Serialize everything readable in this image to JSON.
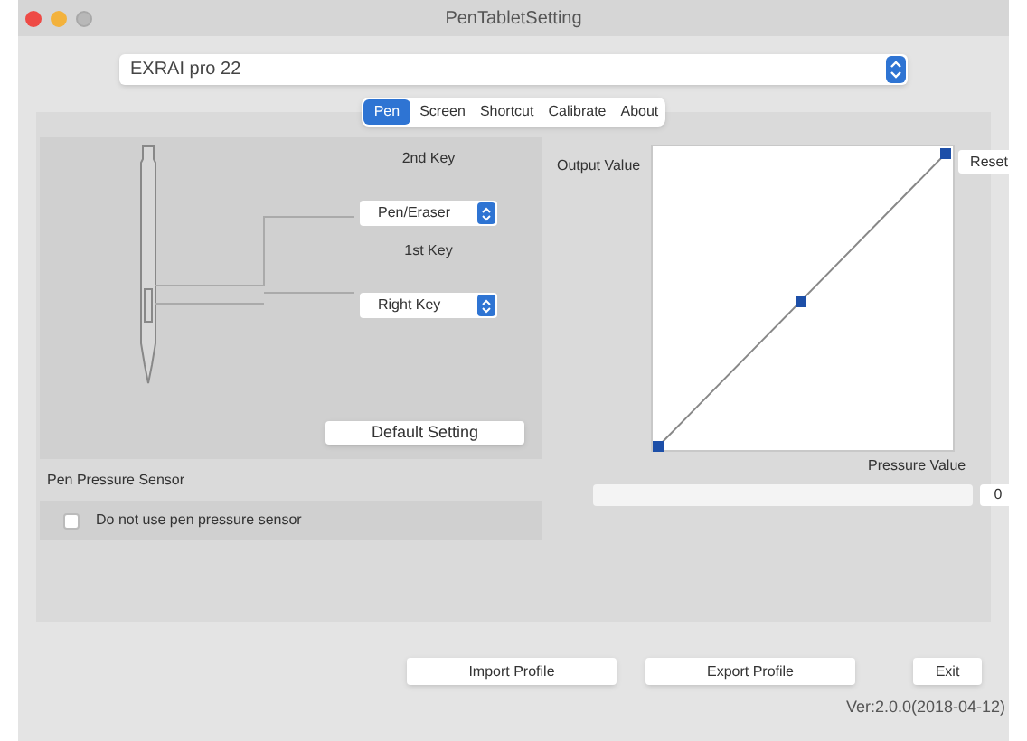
{
  "window": {
    "title": "PenTabletSetting"
  },
  "device_select": {
    "value": "EXRAI pro 22"
  },
  "tabs": [
    {
      "label": "Pen",
      "selected": true
    },
    {
      "label": "Screen",
      "selected": false
    },
    {
      "label": "Shortcut",
      "selected": false
    },
    {
      "label": "Calibrate",
      "selected": false
    },
    {
      "label": "About",
      "selected": false
    }
  ],
  "pen_keys": [
    {
      "label": "2nd Key",
      "value": "Pen/Eraser"
    },
    {
      "label": "1st Key",
      "value": "Right Key"
    }
  ],
  "default_button": "Default Setting",
  "pressure_sensor": {
    "title": "Pen Pressure Sensor",
    "checkbox": {
      "label": "Do not use pen pressure sensor",
      "checked": false
    }
  },
  "curve": {
    "y_label": "Output Value",
    "x_label": "Pressure Value",
    "reset_button": "Reset"
  },
  "pressure_meter": {
    "level": 0,
    "reading": "0"
  },
  "buttons": [
    "Import Profile",
    "Export Profile",
    "Exit"
  ],
  "version": "Ver:2.0.0(2018-04-12)"
}
